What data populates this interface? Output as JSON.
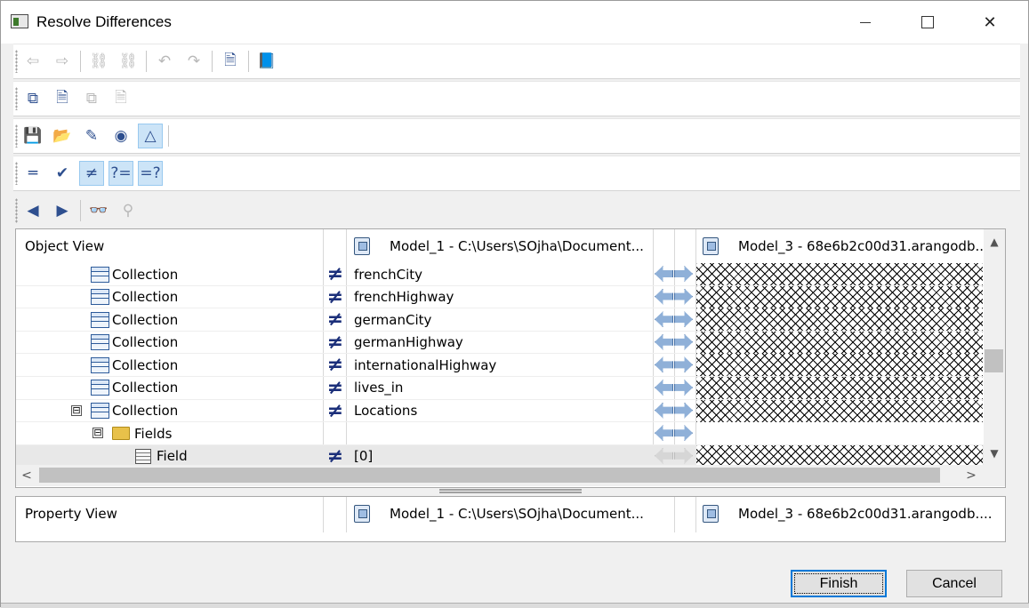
{
  "window": {
    "title": "Resolve Differences",
    "minimize": "—",
    "maximize": "☐",
    "close": "✕"
  },
  "toolbars": [
    {
      "tools": [
        {
          "icon": "arrow-left-icon",
          "glyph": "⇦",
          "enabled": false
        },
        {
          "icon": "arrow-right-icon",
          "glyph": "⇨",
          "enabled": false
        },
        {
          "sep": true
        },
        {
          "icon": "link-icon",
          "glyph": "⛓",
          "enabled": false
        },
        {
          "icon": "unlink-icon",
          "glyph": "⛓",
          "enabled": false
        },
        {
          "sep": true
        },
        {
          "icon": "undo-icon",
          "glyph": "↶",
          "enabled": false
        },
        {
          "icon": "redo-icon",
          "glyph": "↷",
          "enabled": false
        },
        {
          "sep": true
        },
        {
          "icon": "merge-document-icon",
          "glyph": "🗎",
          "enabled": true
        },
        {
          "sep": true
        },
        {
          "icon": "book-icon",
          "glyph": "📘",
          "enabled": true
        }
      ]
    },
    {
      "tools": [
        {
          "icon": "compare-copy-icon",
          "glyph": "⧉",
          "enabled": true
        },
        {
          "icon": "add-document-icon",
          "glyph": "🗎",
          "enabled": true
        },
        {
          "icon": "copy-disabled-icon",
          "glyph": "⧉",
          "enabled": false
        },
        {
          "icon": "export-disabled-icon",
          "glyph": "🗎",
          "enabled": false
        }
      ]
    },
    {
      "tools": [
        {
          "icon": "save-icon",
          "glyph": "💾",
          "enabled": true
        },
        {
          "icon": "open-folder-icon",
          "glyph": "📂",
          "enabled": true
        },
        {
          "icon": "pencil-icon",
          "glyph": "✎",
          "enabled": true
        },
        {
          "icon": "circle-triangle-icon",
          "glyph": "◉",
          "enabled": true
        },
        {
          "icon": "triangle-pencil-icon",
          "glyph": "△",
          "enabled": true,
          "active": true
        },
        {
          "sep": true
        }
      ]
    },
    {
      "tools": [
        {
          "icon": "equal-icon",
          "glyph": "═",
          "enabled": true
        },
        {
          "icon": "approve-icon",
          "glyph": "✔",
          "enabled": true
        },
        {
          "icon": "not-equal-icon",
          "glyph": "≠",
          "enabled": true,
          "active": true
        },
        {
          "icon": "unknown-equal-icon",
          "glyph": "?=",
          "enabled": true,
          "active": true
        },
        {
          "icon": "equal-unknown-icon",
          "glyph": "=?",
          "enabled": true,
          "active": true
        }
      ]
    },
    {
      "tools": [
        {
          "icon": "previous-difference-icon",
          "glyph": "◀",
          "enabled": true
        },
        {
          "icon": "next-difference-icon",
          "glyph": "▶",
          "enabled": true
        },
        {
          "sep": true
        },
        {
          "icon": "binoculars-icon",
          "glyph": "👓",
          "enabled": true
        },
        {
          "icon": "find-next-icon",
          "glyph": "⚲",
          "enabled": false
        }
      ]
    }
  ],
  "object_view": {
    "title": "Object View",
    "left_model": "Model_1 - C:\\Users\\SOjha\\Document...",
    "right_model": "Model_3 - 68e6b2c00d31.arangodb...",
    "rows": [
      {
        "indent": 1,
        "type": "collection",
        "label": "Collection",
        "diff": true,
        "value": "frenchCity",
        "hatched": true
      },
      {
        "indent": 1,
        "type": "collection",
        "label": "Collection",
        "diff": true,
        "value": "frenchHighway",
        "hatched": true
      },
      {
        "indent": 1,
        "type": "collection",
        "label": "Collection",
        "diff": true,
        "value": "germanCity",
        "hatched": true
      },
      {
        "indent": 1,
        "type": "collection",
        "label": "Collection",
        "diff": true,
        "value": "germanHighway",
        "hatched": true
      },
      {
        "indent": 1,
        "type": "collection",
        "label": "Collection",
        "diff": true,
        "value": "internationalHighway",
        "hatched": true
      },
      {
        "indent": 1,
        "type": "collection",
        "label": "Collection",
        "diff": true,
        "value": "lives_in",
        "hatched": true
      },
      {
        "indent": 1,
        "type": "collection",
        "label": "Collection",
        "diff": true,
        "value": "Locations",
        "hatched": true,
        "expander": "⊟"
      },
      {
        "indent": 2,
        "type": "folder",
        "label": "Fields",
        "diff": false,
        "value": "",
        "hatched": false,
        "expander": "⊟"
      },
      {
        "indent": 3,
        "type": "field",
        "label": "Field",
        "diff": true,
        "value": "[0]",
        "hatched": true,
        "selected": true,
        "dim_arrows": true
      }
    ]
  },
  "property_view": {
    "title": "Property View",
    "left_model": "Model_1 - C:\\Users\\SOjha\\Document...",
    "right_model": "Model_3 - 68e6b2c00d31.arangodb...."
  },
  "buttons": {
    "finish": "Finish",
    "cancel": "Cancel"
  },
  "scroll": {
    "up": "▲",
    "down": "▼",
    "left": "<",
    "right": ">"
  },
  "colors": {
    "diff_glyph": "#1b2f7a",
    "focus_border": "#0078d7",
    "active_tool": "#cce4f7"
  }
}
